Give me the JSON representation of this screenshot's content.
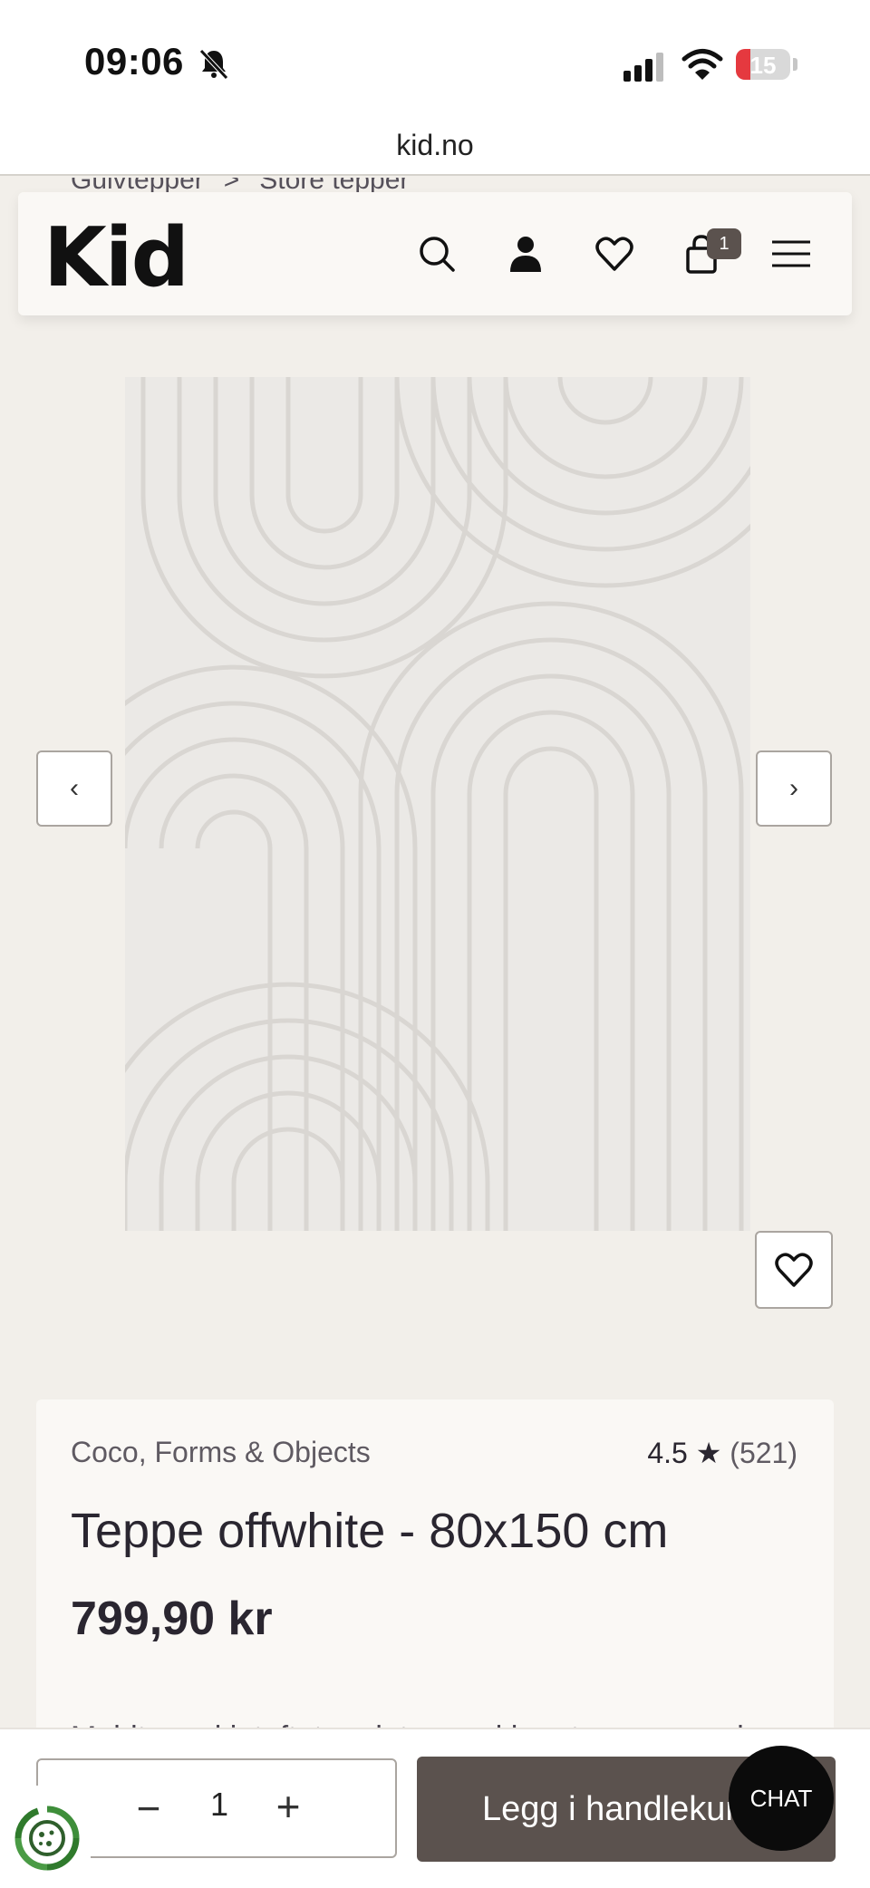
{
  "status_bar": {
    "time": "09:06",
    "battery": "15",
    "battery_level": 0.15
  },
  "browser": {
    "url": "kid.no"
  },
  "breadcrumb": {
    "items": [
      "Gulvtepper",
      "Store tepper"
    ],
    "separator": ">"
  },
  "header": {
    "logo": "Kid",
    "cart_count": "1"
  },
  "gallery": {
    "prev": "‹",
    "next": "›"
  },
  "product": {
    "brand": "Coco, Forms & Objects",
    "rating": "4.5",
    "rating_star": "★",
    "review_count": "(521)",
    "title": "Teppe offwhite - 80x150 cm",
    "price": "799,90 kr",
    "description_preview": "Moldte og kinteftet ... det er ved hverte ... ne rund"
  },
  "cart_bar": {
    "minus": "−",
    "quantity": "1",
    "plus": "+",
    "add_to_cart": "Legg i handlekurv"
  },
  "chat": {
    "label": "CHAT"
  },
  "colors": {
    "accent": "#5b524e",
    "background": "#f2efea",
    "battery": "#e5393f"
  }
}
